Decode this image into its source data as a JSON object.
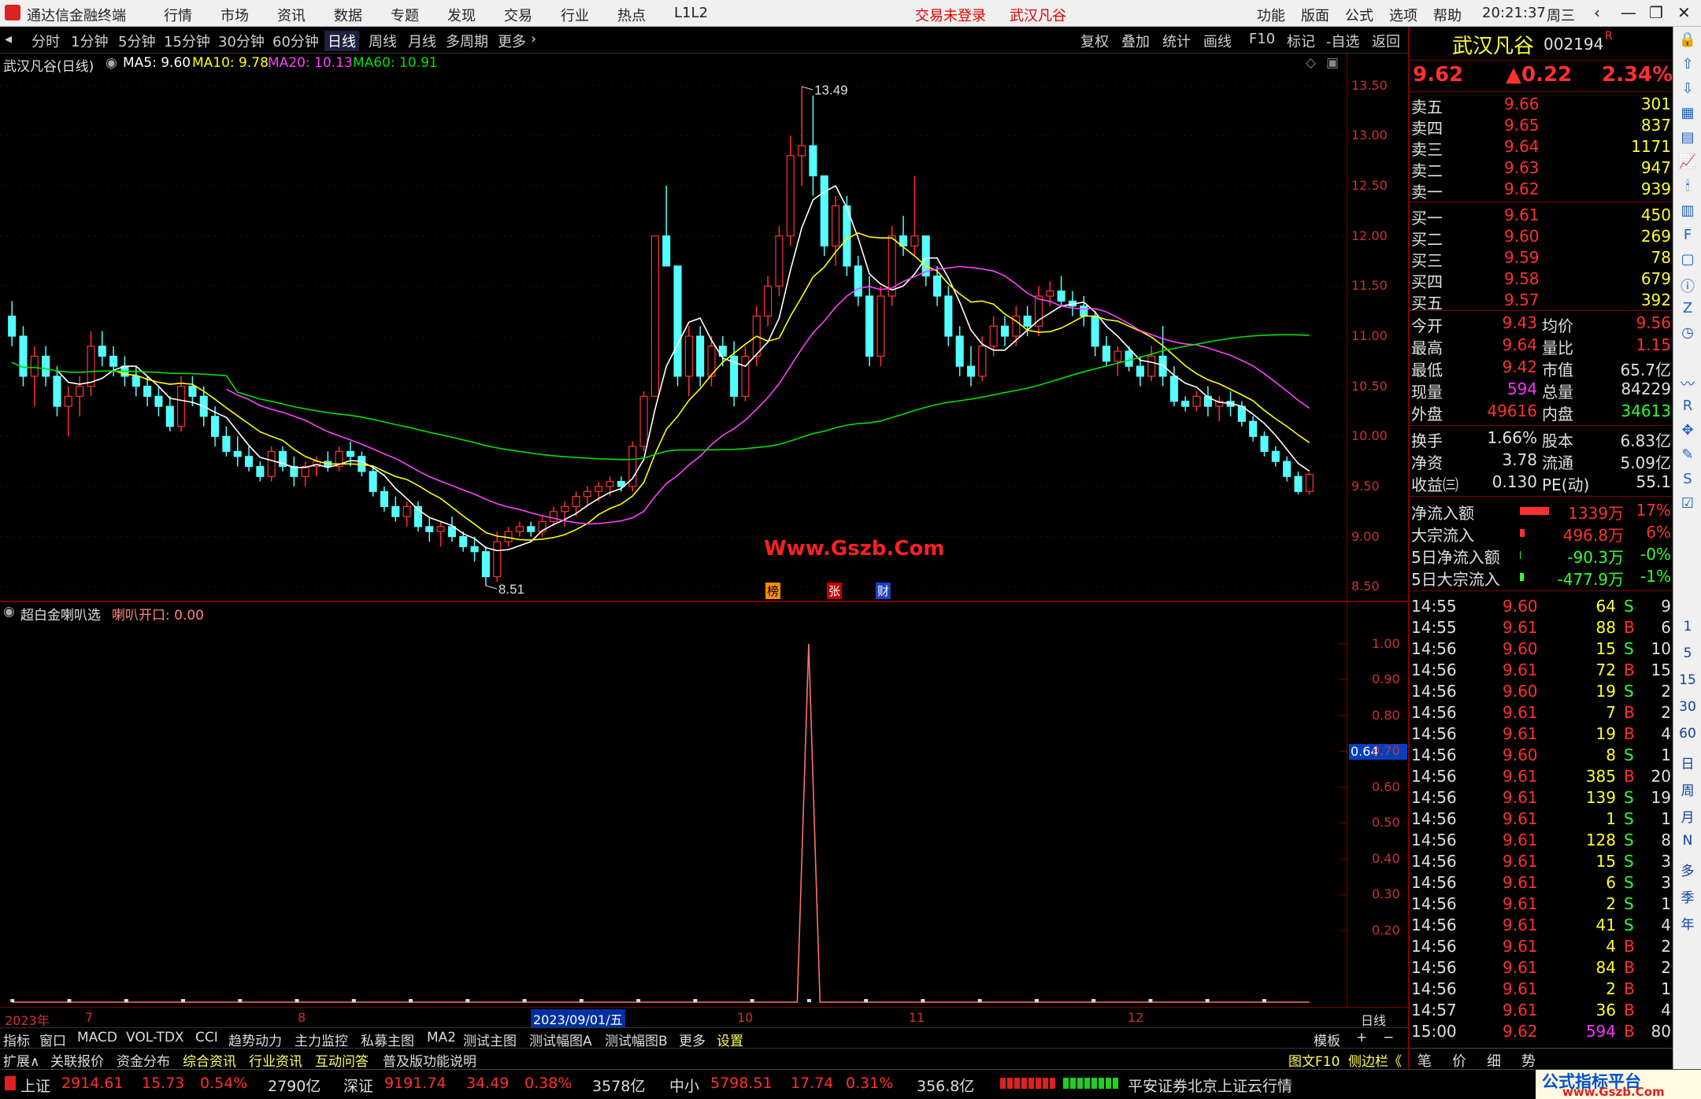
{
  "menubar": {
    "app_title": "通达信金融终端",
    "menus": [
      "行情",
      "市场",
      "资讯",
      "数据",
      "专题",
      "发现",
      "交易",
      "行业",
      "热点",
      "L1L2"
    ],
    "login_status": "交易未登录",
    "stock_name": "武汉凡谷",
    "right_menus": [
      "功能",
      "版面",
      "公式",
      "选项",
      "帮助"
    ],
    "time": "20:21:37",
    "weekday": "周三"
  },
  "toolbar": {
    "periods": [
      "分时",
      "1分钟",
      "5分钟",
      "15分钟",
      "30分钟",
      "60分钟",
      "日线",
      "周线",
      "月线",
      "多周期",
      "更多"
    ],
    "active": "日线",
    "right_buttons": [
      "复权",
      "叠加",
      "统计",
      "画线",
      "F10",
      "标记",
      "-自选",
      "返回"
    ]
  },
  "chart_header": {
    "title": "武汉凡谷(日线)",
    "ma5": "MA5: 9.60",
    "ma10": "MA10: 9.78",
    "ma20": "MA20: 10.13",
    "ma60": "MA60: 10.91",
    "colors": {
      "ma5": "#ffffff",
      "ma10": "#ffff00",
      "ma20": "#ff40ff",
      "ma60": "#00e000",
      "up": "#ff3232",
      "down": "#54ffff"
    }
  },
  "chart_data": [
    {
      "type": "candlestick",
      "title": "武汉凡谷(日线)",
      "y_ticks": [
        "13.50",
        "13.00",
        "12.50",
        "12.00",
        "11.50",
        "11.00",
        "10.50",
        "10.00",
        "9.50",
        "9.00",
        "8.50"
      ],
      "ylim": [
        8.4,
        13.6
      ],
      "high_label": "13.49",
      "low_label": "8.51",
      "watermark": "Www.Gszb.Com",
      "event_marks": [
        "榜",
        "张",
        "财"
      ],
      "series": [
        {
          "name": "MA5",
          "values": [
            9.6
          ]
        },
        {
          "name": "MA10",
          "values": [
            9.78
          ]
        },
        {
          "name": "MA20",
          "values": [
            10.13
          ]
        },
        {
          "name": "MA60",
          "values": [
            10.91
          ]
        }
      ],
      "ohlc": [
        [
          11.2,
          11.35,
          10.9,
          11.0
        ],
        [
          11.0,
          11.1,
          10.5,
          10.6
        ],
        [
          10.6,
          10.9,
          10.3,
          10.8
        ],
        [
          10.8,
          10.9,
          10.5,
          10.6
        ],
        [
          10.6,
          10.7,
          10.2,
          10.3
        ],
        [
          10.3,
          10.5,
          10.0,
          10.4
        ],
        [
          10.4,
          10.6,
          10.2,
          10.5
        ],
        [
          10.5,
          11.05,
          10.4,
          10.9
        ],
        [
          10.9,
          11.05,
          10.7,
          10.8
        ],
        [
          10.8,
          10.9,
          10.6,
          10.7
        ],
        [
          10.7,
          10.8,
          10.5,
          10.6
        ],
        [
          10.6,
          10.7,
          10.4,
          10.5
        ],
        [
          10.5,
          10.6,
          10.3,
          10.4
        ],
        [
          10.4,
          10.5,
          10.2,
          10.3
        ],
        [
          10.3,
          10.4,
          10.05,
          10.1
        ],
        [
          10.1,
          10.6,
          10.05,
          10.5
        ],
        [
          10.5,
          10.6,
          10.3,
          10.4
        ],
        [
          10.4,
          10.5,
          10.1,
          10.2
        ],
        [
          10.2,
          10.3,
          9.9,
          10.0
        ],
        [
          10.0,
          10.1,
          9.8,
          9.85
        ],
        [
          9.85,
          10.0,
          9.7,
          9.8
        ],
        [
          9.8,
          9.9,
          9.65,
          9.7
        ],
        [
          9.7,
          9.75,
          9.55,
          9.6
        ],
        [
          9.6,
          9.9,
          9.55,
          9.85
        ],
        [
          9.85,
          9.9,
          9.65,
          9.7
        ],
        [
          9.7,
          9.8,
          9.5,
          9.6
        ],
        [
          9.6,
          9.75,
          9.5,
          9.7
        ],
        [
          9.7,
          9.8,
          9.6,
          9.75
        ],
        [
          9.75,
          9.85,
          9.65,
          9.7
        ],
        [
          9.7,
          9.9,
          9.65,
          9.85
        ],
        [
          9.85,
          9.95,
          9.7,
          9.8
        ],
        [
          9.8,
          9.85,
          9.6,
          9.65
        ],
        [
          9.65,
          9.7,
          9.4,
          9.45
        ],
        [
          9.45,
          9.5,
          9.25,
          9.3
        ],
        [
          9.3,
          9.4,
          9.15,
          9.2
        ],
        [
          9.2,
          9.35,
          9.1,
          9.3
        ],
        [
          9.3,
          9.35,
          9.05,
          9.1
        ],
        [
          9.1,
          9.2,
          8.95,
          9.05
        ],
        [
          9.05,
          9.15,
          8.9,
          9.1
        ],
        [
          9.1,
          9.2,
          8.95,
          9.0
        ],
        [
          9.0,
          9.05,
          8.85,
          8.9
        ],
        [
          8.9,
          9.0,
          8.75,
          8.85
        ],
        [
          8.85,
          8.9,
          8.51,
          8.6
        ],
        [
          8.6,
          9.05,
          8.55,
          8.95
        ],
        [
          8.95,
          9.1,
          8.9,
          9.05
        ],
        [
          9.05,
          9.15,
          9.0,
          9.1
        ],
        [
          9.1,
          9.15,
          9.0,
          9.05
        ],
        [
          9.05,
          9.2,
          9.0,
          9.15
        ],
        [
          9.15,
          9.3,
          9.1,
          9.25
        ],
        [
          9.25,
          9.35,
          9.1,
          9.3
        ],
        [
          9.3,
          9.45,
          9.2,
          9.4
        ],
        [
          9.4,
          9.5,
          9.3,
          9.45
        ],
        [
          9.45,
          9.55,
          9.35,
          9.5
        ],
        [
          9.5,
          9.6,
          9.4,
          9.55
        ],
        [
          9.55,
          9.6,
          9.45,
          9.5
        ],
        [
          9.5,
          9.95,
          9.45,
          9.9
        ],
        [
          9.9,
          10.45,
          9.85,
          10.4
        ],
        [
          10.4,
          12.0,
          10.4,
          12.0
        ],
        [
          12.0,
          12.5,
          11.7,
          11.7
        ],
        [
          11.7,
          11.4,
          10.5,
          10.6
        ],
        [
          10.6,
          11.1,
          10.4,
          11.0
        ],
        [
          11.0,
          11.1,
          10.5,
          10.6
        ],
        [
          10.6,
          11.0,
          10.5,
          10.9
        ],
        [
          10.9,
          11.0,
          10.7,
          10.8
        ],
        [
          10.8,
          10.95,
          10.3,
          10.4
        ],
        [
          10.4,
          10.9,
          10.35,
          10.8
        ],
        [
          10.8,
          11.3,
          10.7,
          11.2
        ],
        [
          11.2,
          11.6,
          11.1,
          11.5
        ],
        [
          11.5,
          12.1,
          11.4,
          12.0
        ],
        [
          12.0,
          13.0,
          11.9,
          12.8
        ],
        [
          12.8,
          13.49,
          12.5,
          12.9
        ],
        [
          12.9,
          13.4,
          12.4,
          12.6
        ],
        [
          12.6,
          12.6,
          11.8,
          11.9
        ],
        [
          11.9,
          12.4,
          11.7,
          12.3
        ],
        [
          12.3,
          12.4,
          11.6,
          11.7
        ],
        [
          11.7,
          11.8,
          11.3,
          11.4
        ],
        [
          11.4,
          11.6,
          10.7,
          10.8
        ],
        [
          10.8,
          11.5,
          10.7,
          11.4
        ],
        [
          11.4,
          12.1,
          11.3,
          12.0
        ],
        [
          12.0,
          12.2,
          11.8,
          11.9
        ],
        [
          11.9,
          12.6,
          11.8,
          12.0
        ],
        [
          12.0,
          12.0,
          11.5,
          11.6
        ],
        [
          11.6,
          11.7,
          11.3,
          11.4
        ],
        [
          11.4,
          11.5,
          10.9,
          11.0
        ],
        [
          11.0,
          11.1,
          10.6,
          10.7
        ],
        [
          10.7,
          10.9,
          10.5,
          10.6
        ],
        [
          10.6,
          11.0,
          10.55,
          10.9
        ],
        [
          10.9,
          11.2,
          10.8,
          11.1
        ],
        [
          11.1,
          11.2,
          10.9,
          11.0
        ],
        [
          11.0,
          11.3,
          10.9,
          11.2
        ],
        [
          11.2,
          11.3,
          11.0,
          11.1
        ],
        [
          11.1,
          11.5,
          11.0,
          11.4
        ],
        [
          11.4,
          11.55,
          11.3,
          11.45
        ],
        [
          11.45,
          11.6,
          11.3,
          11.35
        ],
        [
          11.35,
          11.45,
          11.2,
          11.3
        ],
        [
          11.3,
          11.4,
          11.1,
          11.2
        ],
        [
          11.2,
          11.25,
          10.8,
          10.9
        ],
        [
          10.9,
          11.0,
          10.7,
          10.75
        ],
        [
          10.75,
          10.9,
          10.6,
          10.85
        ],
        [
          10.85,
          10.9,
          10.65,
          10.7
        ],
        [
          10.7,
          10.8,
          10.5,
          10.6
        ],
        [
          10.6,
          10.9,
          10.55,
          10.8
        ],
        [
          10.8,
          11.1,
          10.5,
          10.6
        ],
        [
          10.6,
          10.7,
          10.3,
          10.35
        ],
        [
          10.35,
          10.4,
          10.25,
          10.3
        ],
        [
          10.3,
          10.45,
          10.25,
          10.4
        ],
        [
          10.4,
          10.5,
          10.2,
          10.3
        ],
        [
          10.3,
          10.4,
          10.15,
          10.35
        ],
        [
          10.35,
          10.45,
          10.2,
          10.3
        ],
        [
          10.3,
          10.35,
          10.1,
          10.15
        ],
        [
          10.15,
          10.2,
          9.95,
          10.0
        ],
        [
          10.0,
          10.05,
          9.8,
          9.85
        ],
        [
          9.85,
          9.9,
          9.7,
          9.75
        ],
        [
          9.75,
          9.8,
          9.55,
          9.6
        ],
        [
          9.6,
          9.65,
          9.42,
          9.45
        ],
        [
          9.45,
          9.64,
          9.42,
          9.62
        ]
      ]
    },
    {
      "type": "line",
      "title": "超白金喇叭选",
      "series_name": "喇叭开口: 0.00",
      "y_ticks": [
        "1.00",
        "0.90",
        "0.80",
        "0.70",
        "0.60",
        "0.50",
        "0.40",
        "0.30",
        "0.20"
      ],
      "cursor_value": "0.64",
      "ylim": [
        0,
        1.05
      ],
      "spike_index": 70,
      "spike_value": 1.0,
      "n": 115
    }
  ],
  "date_axis": {
    "labels": [
      "2023年",
      "7",
      "8",
      "2023/09/01/五",
      "10",
      "11",
      "12"
    ],
    "period": "日线"
  },
  "tabs_row1": {
    "items": [
      "指标",
      "窗口",
      "MACD",
      "VOL-TDX",
      "CCI",
      "趋势动力",
      "主力监控",
      "私募主图",
      "MA2",
      "测试主图",
      "测试幅图A",
      "测试幅图B",
      "更多",
      "设置"
    ],
    "template": "模板",
    "plus": "+",
    "minus": "−"
  },
  "tabs_row2": {
    "items": [
      "扩展∧",
      "关联报价",
      "资金分布",
      "综合资讯",
      "行业资讯",
      "互动问答",
      "普及版功能说明"
    ],
    "right": [
      "图文F10",
      "侧边栏《"
    ],
    "extra": [
      "笔",
      "价",
      "细",
      "势"
    ]
  },
  "quote": {
    "name": "武汉凡谷",
    "code": "002194",
    "flag": "R",
    "price": "9.62",
    "change": "▲0.22",
    "pct": "2.34%",
    "asks": [
      {
        "label": "卖五",
        "price": "9.66",
        "vol": "301"
      },
      {
        "label": "卖四",
        "price": "9.65",
        "vol": "837"
      },
      {
        "label": "卖三",
        "price": "9.64",
        "vol": "1171"
      },
      {
        "label": "卖二",
        "price": "9.63",
        "vol": "947"
      },
      {
        "label": "卖一",
        "price": "9.62",
        "vol": "939"
      }
    ],
    "bids": [
      {
        "label": "买一",
        "price": "9.61",
        "vol": "450"
      },
      {
        "label": "买二",
        "price": "9.60",
        "vol": "269"
      },
      {
        "label": "买三",
        "price": "9.59",
        "vol": "78"
      },
      {
        "label": "买四",
        "price": "9.58",
        "vol": "679"
      },
      {
        "label": "买五",
        "price": "9.57",
        "vol": "392"
      }
    ],
    "stats": [
      [
        "今开",
        "9.43",
        "均价",
        "9.56"
      ],
      [
        "最高",
        "9.64",
        "量比",
        "1.15"
      ],
      [
        "最低",
        "9.42",
        "市值",
        "65.7亿"
      ],
      [
        "现量",
        "594",
        "总量",
        "84229"
      ],
      [
        "外盘",
        "49616",
        "内盘",
        "34613"
      ]
    ],
    "stats2": [
      [
        "换手",
        "1.66%",
        "股本",
        "6.83亿"
      ],
      [
        "净资",
        "3.78",
        "流通",
        "5.09亿"
      ],
      [
        "收益㈢",
        "0.130",
        "PE(动)",
        "55.1"
      ]
    ],
    "flows": [
      {
        "label": "净流入额",
        "value": "1339万",
        "pct": "17%"
      },
      {
        "label": "大宗流入",
        "value": "496.8万",
        "pct": "6%"
      },
      {
        "label": "5日净流入额",
        "value": "-90.3万",
        "pct": "-0%"
      },
      {
        "label": "5日大宗流入",
        "value": "-477.9万",
        "pct": "-1%"
      }
    ],
    "ticks": [
      [
        "14:55",
        "9.60",
        "64",
        "S",
        "9"
      ],
      [
        "14:55",
        "9.61",
        "88",
        "B",
        "6"
      ],
      [
        "14:56",
        "9.60",
        "15",
        "S",
        "10"
      ],
      [
        "14:56",
        "9.61",
        "72",
        "B",
        "15"
      ],
      [
        "14:56",
        "9.60",
        "19",
        "S",
        "2"
      ],
      [
        "14:56",
        "9.61",
        "7",
        "B",
        "2"
      ],
      [
        "14:56",
        "9.61",
        "19",
        "B",
        "4"
      ],
      [
        "14:56",
        "9.60",
        "8",
        "S",
        "1"
      ],
      [
        "14:56",
        "9.61",
        "385",
        "B",
        "20"
      ],
      [
        "14:56",
        "9.61",
        "139",
        "S",
        "19"
      ],
      [
        "14:56",
        "9.61",
        "1",
        "S",
        "1"
      ],
      [
        "14:56",
        "9.61",
        "128",
        "S",
        "8"
      ],
      [
        "14:56",
        "9.61",
        "15",
        "S",
        "3"
      ],
      [
        "14:56",
        "9.61",
        "6",
        "S",
        "3"
      ],
      [
        "14:56",
        "9.61",
        "2",
        "S",
        "1"
      ],
      [
        "14:56",
        "9.61",
        "41",
        "S",
        "4"
      ],
      [
        "14:56",
        "9.61",
        "4",
        "B",
        "2"
      ],
      [
        "14:56",
        "9.61",
        "84",
        "B",
        "2"
      ],
      [
        "14:56",
        "9.61",
        "2",
        "B",
        "1"
      ],
      [
        "14:57",
        "9.61",
        "36",
        "B",
        "4"
      ],
      [
        "15:00",
        "9.62",
        "594",
        "B",
        "80"
      ]
    ]
  },
  "sidebar": {
    "labels": [
      "1",
      "5",
      "15",
      "30",
      "60",
      "日",
      "周",
      "月",
      "N",
      "多",
      "季",
      "年"
    ]
  },
  "statusbar": {
    "sh": {
      "name": "上证",
      "val": "2914.61",
      "chg": "15.73",
      "pct": "0.54%",
      "amt": "2790亿"
    },
    "sz": {
      "name": "深证",
      "val": "9191.74",
      "chg": "34.49",
      "pct": "0.38%",
      "amt": "3578亿"
    },
    "zx": {
      "name": "中小",
      "val": "5798.51",
      "chg": "17.74",
      "pct": "0.31%",
      "amt": "356.8亿"
    },
    "server": "平安证券北京上证云行情",
    "brand": "公式指标平台",
    "brand_url": "www.Gszb.Com"
  }
}
